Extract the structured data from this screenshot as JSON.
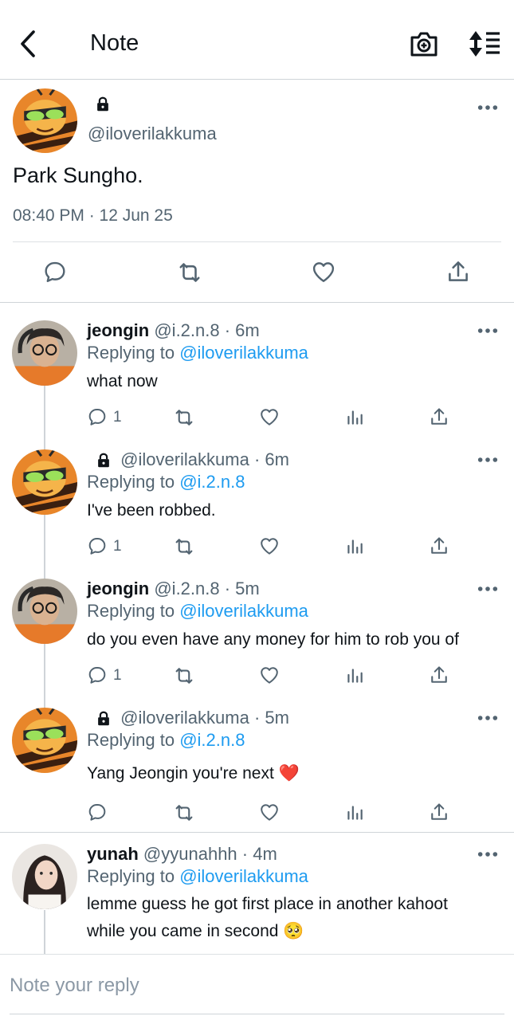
{
  "header": {
    "title": "Note"
  },
  "main_note": {
    "handle": "@iloverilakkuma",
    "text": "Park Sungho.",
    "timestamp": "08:40 PM · 12 Jun 25"
  },
  "replies": [
    {
      "name": "jeongin",
      "handle": "@i.2.n.8",
      "time": "· 6m",
      "replying_label": "Replying to",
      "replying_to": "@iloverilakkuma",
      "text": "what now",
      "reply_count": "1"
    },
    {
      "name": "",
      "handle": "@iloverilakkuma",
      "time": "· 6m",
      "replying_label": "Replying to",
      "replying_to": "@i.2.n.8",
      "text": "I've been robbed.",
      "reply_count": "1"
    },
    {
      "name": "jeongin",
      "handle": "@i.2.n.8",
      "time": "· 5m",
      "replying_label": "Replying to",
      "replying_to": "@iloverilakkuma",
      "text": "do you even have any money for him to rob you of",
      "reply_count": "1"
    },
    {
      "name": "",
      "handle": "@iloverilakkuma",
      "time": "· 5m",
      "replying_label": "Replying to",
      "replying_to": "@i.2.n.8",
      "text": "Yang Jeongin you're next ❤️",
      "reply_count": ""
    },
    {
      "name": "yunah",
      "handle": "@yyunahhh",
      "time": "· 4m",
      "replying_label": "Replying to",
      "replying_to": "@iloverilakkuma",
      "text_line1": "lemme guess he got first place in another kahoot",
      "text_line2": "while you came in second 🥺"
    }
  ],
  "composer": {
    "placeholder": "Note your reply"
  },
  "icons": [
    "back-arrow-icon",
    "camera-add-icon",
    "sort-icon",
    "lock-icon",
    "more-icon",
    "comment-icon",
    "retweet-icon",
    "heart-icon",
    "stats-icon",
    "share-icon"
  ],
  "colors": {
    "link": "#1d9bf0",
    "muted": "#536471",
    "text": "#0f1419",
    "divider": "#cfd4d8"
  }
}
